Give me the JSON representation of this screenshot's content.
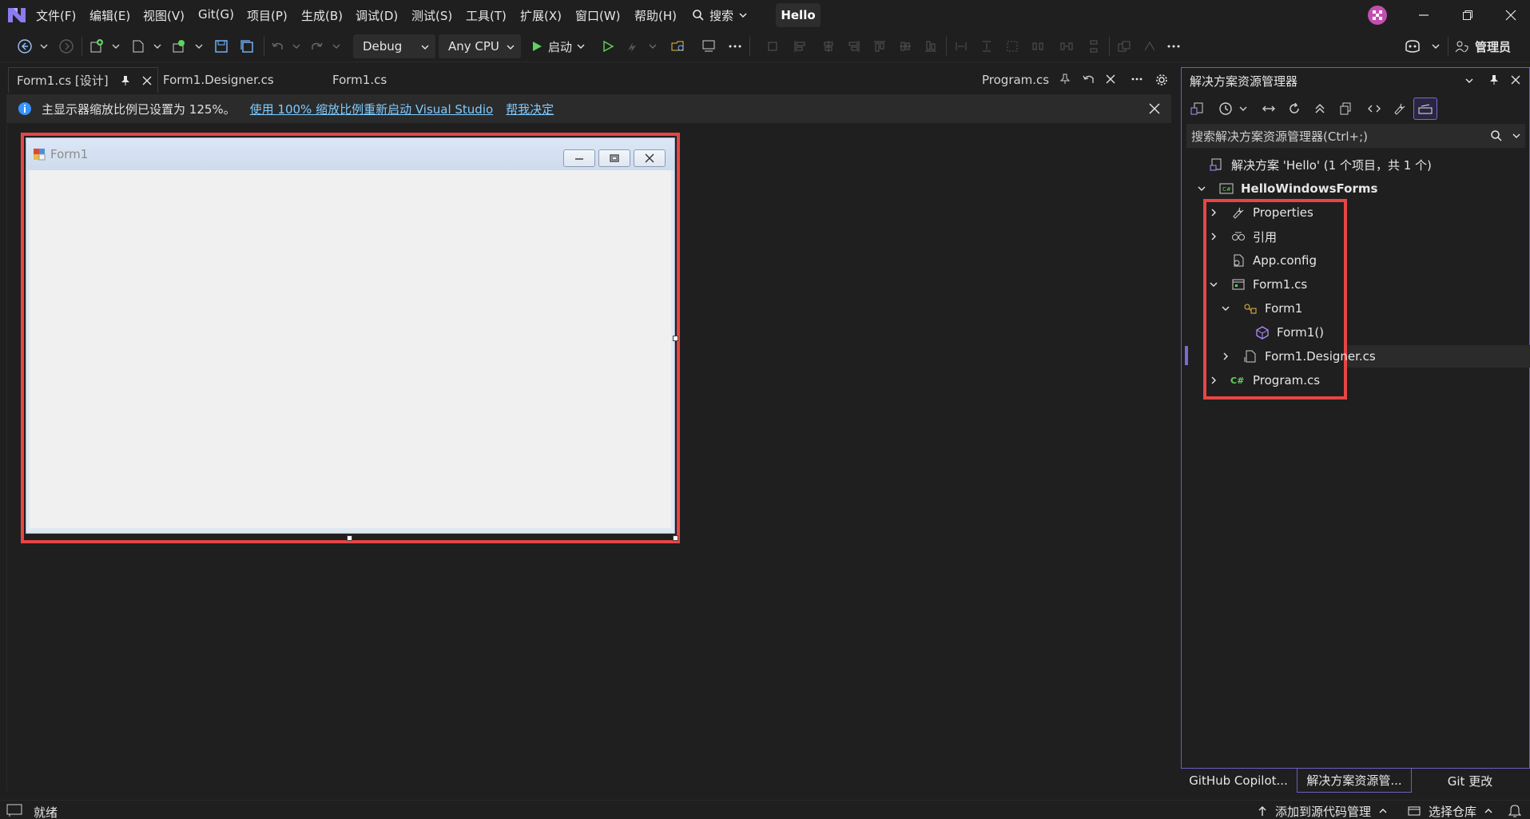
{
  "menubar": {
    "items": [
      "文件(F)",
      "编辑(E)",
      "视图(V)",
      "Git(G)",
      "项目(P)",
      "生成(B)",
      "调试(D)",
      "测试(S)",
      "工具(T)",
      "扩展(X)",
      "窗口(W)",
      "帮助(H)"
    ],
    "search_label": "搜索",
    "solution_name": "Hello"
  },
  "toolbar": {
    "configuration": "Debug",
    "platform": "Any CPU",
    "start_label": "启动",
    "admin_label": "管理员"
  },
  "tabs": {
    "active": "Form1.cs [设计]",
    "designer": "Form1.Designer.cs",
    "code": "Form1.cs",
    "program": "Program.cs"
  },
  "infobar": {
    "message": "主显示器缩放比例已设置为 125%。",
    "restart_link": "使用 100% 缩放比例重新启动 Visual Studio",
    "help_link": "帮我决定"
  },
  "form": {
    "title": "Form1"
  },
  "solution_explorer": {
    "title": "解决方案资源管理器",
    "search_placeholder": "搜索解决方案资源管理器(Ctrl+;)",
    "solution_label": "解决方案 'Hello' (1 个项目，共 1 个)",
    "project": "HelloWindowsForms",
    "items": {
      "properties": "Properties",
      "references": "引用",
      "app_config": "App.config",
      "form1_cs": "Form1.cs",
      "form1_class": "Form1",
      "form1_ctor": "Form1()",
      "form1_designer": "Form1.Designer.cs",
      "program_cs": "Program.cs"
    }
  },
  "bottom_tabs": [
    "GitHub Copilot...",
    "解决方案资源管...",
    "Git 更改"
  ],
  "statusbar": {
    "ready": "就绪",
    "source_control": "添加到源代码管理",
    "repository": "选择仓库"
  },
  "colors": {
    "accent": "#7c68d6",
    "highlight": "#e84545",
    "link": "#7ecbff",
    "run": "#5fd35f"
  }
}
